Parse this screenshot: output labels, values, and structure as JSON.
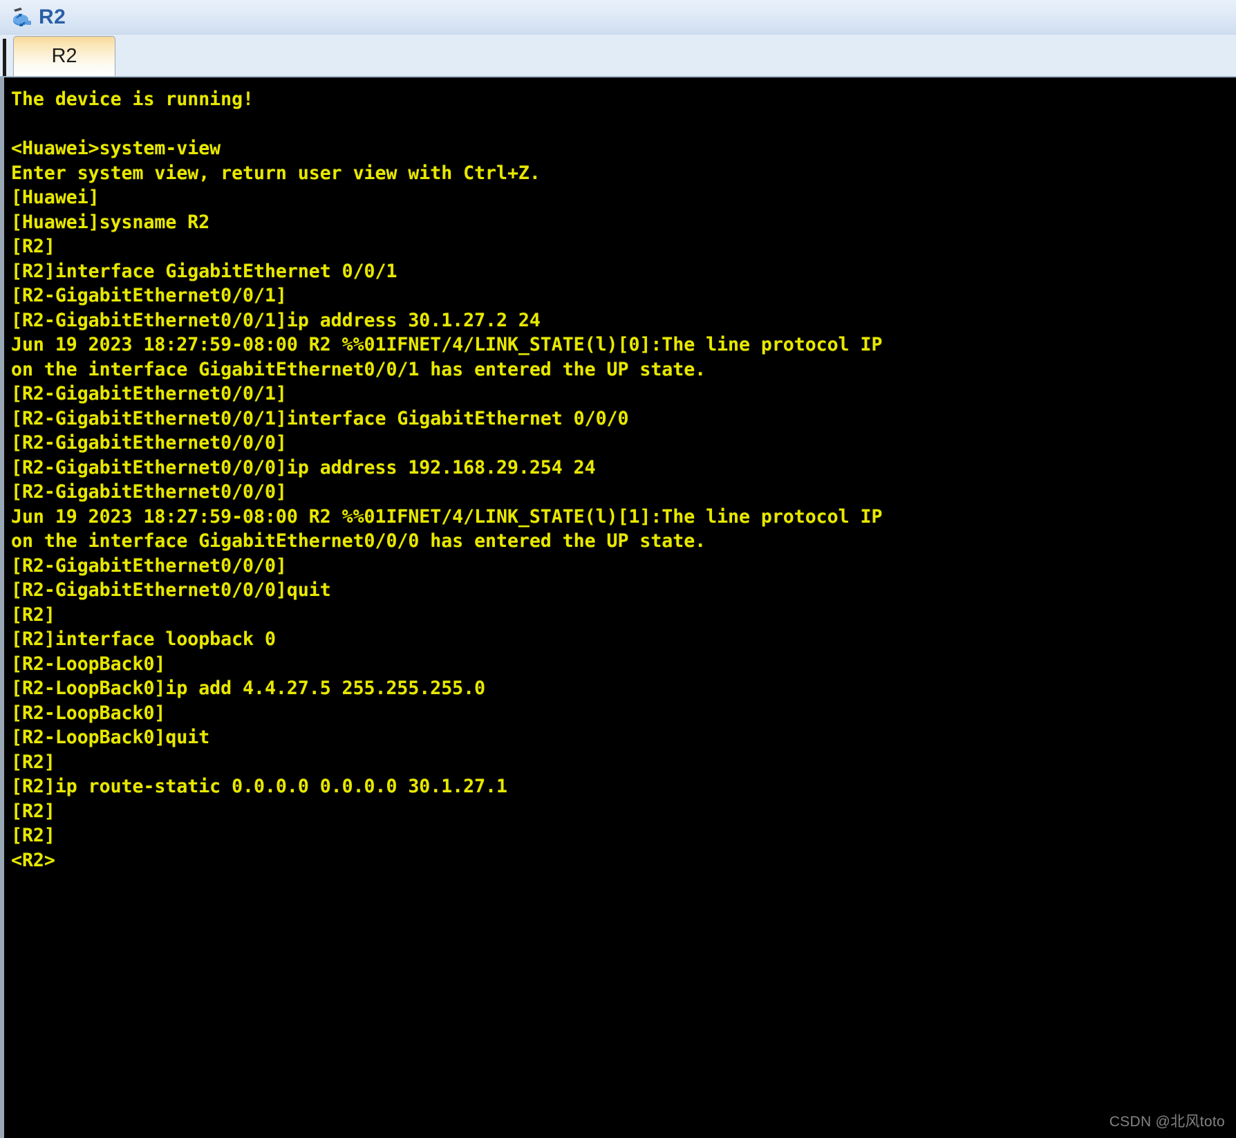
{
  "window": {
    "title": "R2",
    "icon": "router-icon"
  },
  "tabs": [
    {
      "label": "R2",
      "active": true
    }
  ],
  "terminal": {
    "foreground_color": "#e8e800",
    "background_color": "#000000",
    "lines": [
      "The device is running!",
      "",
      "<Huawei>system-view",
      "Enter system view, return user view with Ctrl+Z.",
      "[Huawei]",
      "[Huawei]sysname R2",
      "[R2]",
      "[R2]interface GigabitEthernet 0/0/1",
      "[R2-GigabitEthernet0/0/1]",
      "[R2-GigabitEthernet0/0/1]ip address 30.1.27.2 24",
      "Jun 19 2023 18:27:59-08:00 R2 %%01IFNET/4/LINK_STATE(l)[0]:The line protocol IP",
      "on the interface GigabitEthernet0/0/1 has entered the UP state.",
      "[R2-GigabitEthernet0/0/1]",
      "[R2-GigabitEthernet0/0/1]interface GigabitEthernet 0/0/0",
      "[R2-GigabitEthernet0/0/0]",
      "[R2-GigabitEthernet0/0/0]ip address 192.168.29.254 24",
      "[R2-GigabitEthernet0/0/0]",
      "Jun 19 2023 18:27:59-08:00 R2 %%01IFNET/4/LINK_STATE(l)[1]:The line protocol IP",
      "on the interface GigabitEthernet0/0/0 has entered the UP state.",
      "[R2-GigabitEthernet0/0/0]",
      "[R2-GigabitEthernet0/0/0]quit",
      "[R2]",
      "[R2]interface loopback 0",
      "[R2-LoopBack0]",
      "[R2-LoopBack0]ip add 4.4.27.5 255.255.255.0",
      "[R2-LoopBack0]",
      "[R2-LoopBack0]quit",
      "[R2]",
      "[R2]ip route-static 0.0.0.0 0.0.0.0 30.1.27.1",
      "[R2]",
      "[R2]",
      "<R2>"
    ]
  },
  "watermark": {
    "text": "CSDN @北风toto"
  }
}
